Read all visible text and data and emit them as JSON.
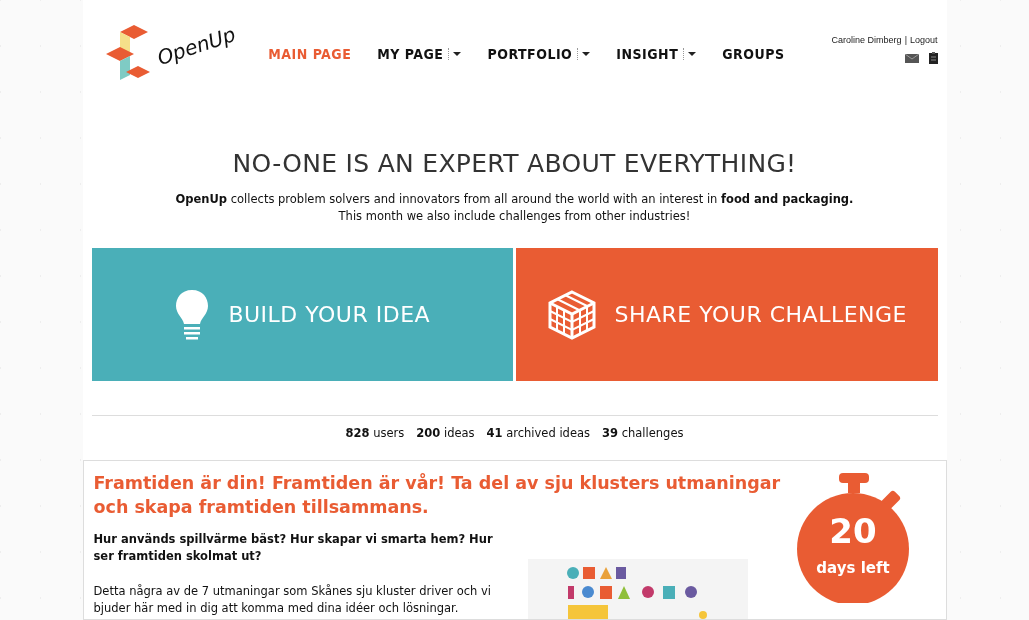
{
  "logo": {
    "text": "OpenUp"
  },
  "nav": [
    {
      "label": "MAIN PAGE",
      "selected": true,
      "dropdown": false
    },
    {
      "label": "MY PAGE",
      "selected": false,
      "dropdown": true
    },
    {
      "label": "PORTFOLIO",
      "selected": false,
      "dropdown": true
    },
    {
      "label": "INSIGHT",
      "selected": false,
      "dropdown": true
    },
    {
      "label": "GROUPS",
      "selected": false,
      "dropdown": false
    }
  ],
  "user": {
    "name": "Caroline Dimberg",
    "separator": "|",
    "logout": "Logout"
  },
  "headline": "NO-ONE IS AN EXPERT ABOUT EVERYTHING!",
  "intro": [
    "**OpenUp** collects problem solvers and innovators from all around the world with an interest in **food and packaging.**",
    "This month we also include challenges from other industries!"
  ],
  "tiles": [
    {
      "kind": "idea",
      "label": "BUILD YOUR IDEA",
      "color": "#4aafb8"
    },
    {
      "kind": "challenge",
      "label": "SHARE YOUR CHALLENGE",
      "color": "#e95c33"
    }
  ],
  "stats": [
    {
      "count": "828",
      "label": "users"
    },
    {
      "count": "200",
      "label": "ideas"
    },
    {
      "count": "41",
      "label": "archived ideas"
    },
    {
      "count": "39",
      "label": "challenges"
    }
  ],
  "feature": {
    "title": "Framtiden är din! Framtiden är vår! Ta del av sju klusters utmaningar och skapa framtiden tillsammans.",
    "question": "Hur används spillvärme bäst? Hur skapar vi smarta hem? Hur ser framtiden skolmat ut?",
    "body": "Detta några av de 7 utmaningar som Skånes sju kluster driver  och vi bjuder här med in dig att komma med dina idéer och lösningar.",
    "timer": {
      "number": "20",
      "label": "days left"
    }
  }
}
